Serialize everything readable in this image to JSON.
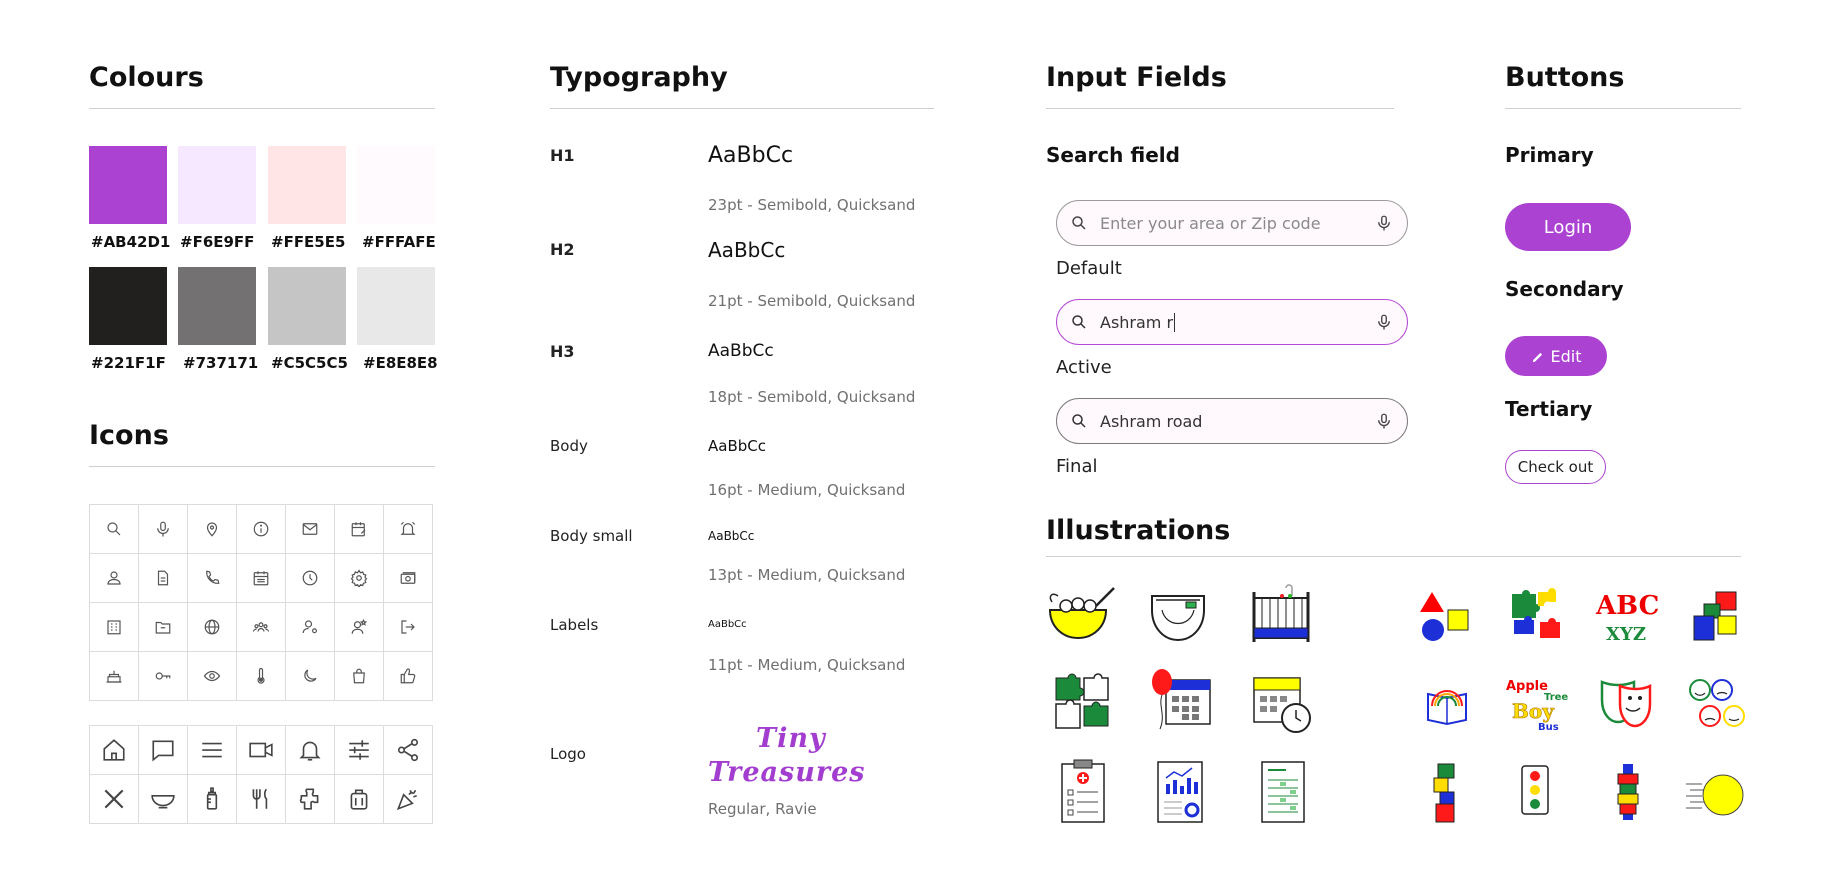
{
  "sections": {
    "colours": "Colours",
    "icons": "Icons",
    "typography": "Typography",
    "input_fields": "Input Fields",
    "buttons": "Buttons",
    "illustrations": "Illustrations"
  },
  "colours": [
    {
      "hex": "#AB42D1",
      "label": "#AB42D1"
    },
    {
      "hex": "#F6E9FF",
      "label": "#F6E9FF"
    },
    {
      "hex": "#FFE5E5",
      "label": "#FFE5E5"
    },
    {
      "hex": "#FFFAFE",
      "label": "#FFFAFE"
    },
    {
      "hex": "#221F1F",
      "label": "#221F1F"
    },
    {
      "hex": "#737171",
      "label": "#737171"
    },
    {
      "hex": "#C5C5C5",
      "label": "#C5C5C5"
    },
    {
      "hex": "#E8E8E8",
      "label": "#E8E8E8"
    }
  ],
  "icon_grid_small": [
    [
      "search-icon",
      "mic-icon",
      "location-pin-icon",
      "info-icon",
      "mail-icon",
      "calendar-edit-icon",
      "alarm-icon"
    ],
    [
      "user-icon",
      "document-icon",
      "phone-icon",
      "calendar-icon",
      "clock-icon",
      "settings-icon",
      "money-icon"
    ],
    [
      "building-icon",
      "folder-icon",
      "globe-icon",
      "group-icon",
      "user-settings-icon",
      "user-star-icon",
      "logout-icon"
    ],
    [
      "cake-icon",
      "key-icon",
      "eye-icon",
      "thermometer-icon",
      "moon-icon",
      "shopping-bag-icon",
      "thumbs-up-icon"
    ]
  ],
  "icon_grid_large": [
    [
      "home-icon",
      "chat-icon",
      "menu-icon",
      "video-icon",
      "bell-icon",
      "sliders-icon",
      "share-icon"
    ],
    [
      "close-icon",
      "bowl-icon",
      "baby-bottle-icon",
      "cutlery-icon",
      "puzzle-icon",
      "diaper-bag-icon",
      "party-icon"
    ]
  ],
  "typography": [
    {
      "label": "H1",
      "sample": "AaBbCc",
      "meta": "23pt - Semibold, Quicksand"
    },
    {
      "label": "H2",
      "sample": "AaBbCc",
      "meta": "21pt - Semibold, Quicksand"
    },
    {
      "label": "H3",
      "sample": "AaBbCc",
      "meta": "18pt - Semibold, Quicksand"
    },
    {
      "label": "Body",
      "sample": "AaBbCc",
      "meta": "16pt - Medium, Quicksand"
    },
    {
      "label": "Body small",
      "sample": "AaBbCc",
      "meta": "13pt - Medium, Quicksand"
    },
    {
      "label": "Labels",
      "sample": "AaBbCc",
      "meta": "11pt - Medium, Quicksand"
    }
  ],
  "logo": {
    "label": "Logo",
    "line1": "Tiny",
    "line2": "Treasures",
    "meta": "Regular, Ravie",
    "colour": "#A23DCF"
  },
  "inputs": {
    "title": "Search field",
    "default": {
      "placeholder": "Enter your area or Zip code",
      "state": "Default"
    },
    "active": {
      "value": "Ashram r",
      "state": "Active"
    },
    "final": {
      "value": "Ashram road",
      "state": "Final"
    }
  },
  "buttons": {
    "primary_title": "Primary",
    "primary_label": "Login",
    "secondary_title": "Secondary",
    "secondary_label": "Edit",
    "tertiary_title": "Tertiary",
    "tertiary_label": "Check out"
  },
  "illustrations": [
    [
      "baby-food-bowl-illustration",
      "diaper-illustration",
      "crib-illustration",
      "shapes-illustration",
      "puzzle-pieces-illustration",
      "alphabet-blocks-illustration",
      "colored-blocks-illustration"
    ],
    [
      "puzzle-outline-illustration",
      "balloon-calendar-illustration",
      "calendar-clock-illustration",
      "rainbow-book-illustration",
      "apple-tree-boy-bus-illustration",
      "masks-illustration",
      "emotion-faces-illustration"
    ],
    [
      "clipboard-illustration",
      "report-illustration",
      "checklist-illustration",
      "stacked-blocks-illustration",
      "traffic-light-illustration",
      "block-tower-illustration",
      "moving-ball-illustration"
    ]
  ],
  "illustration_text": {
    "apple": "Apple",
    "tree": "Tree",
    "boy": "Boy",
    "bus": "Bus",
    "abc": "ABC",
    "xyz": "XYZ"
  }
}
